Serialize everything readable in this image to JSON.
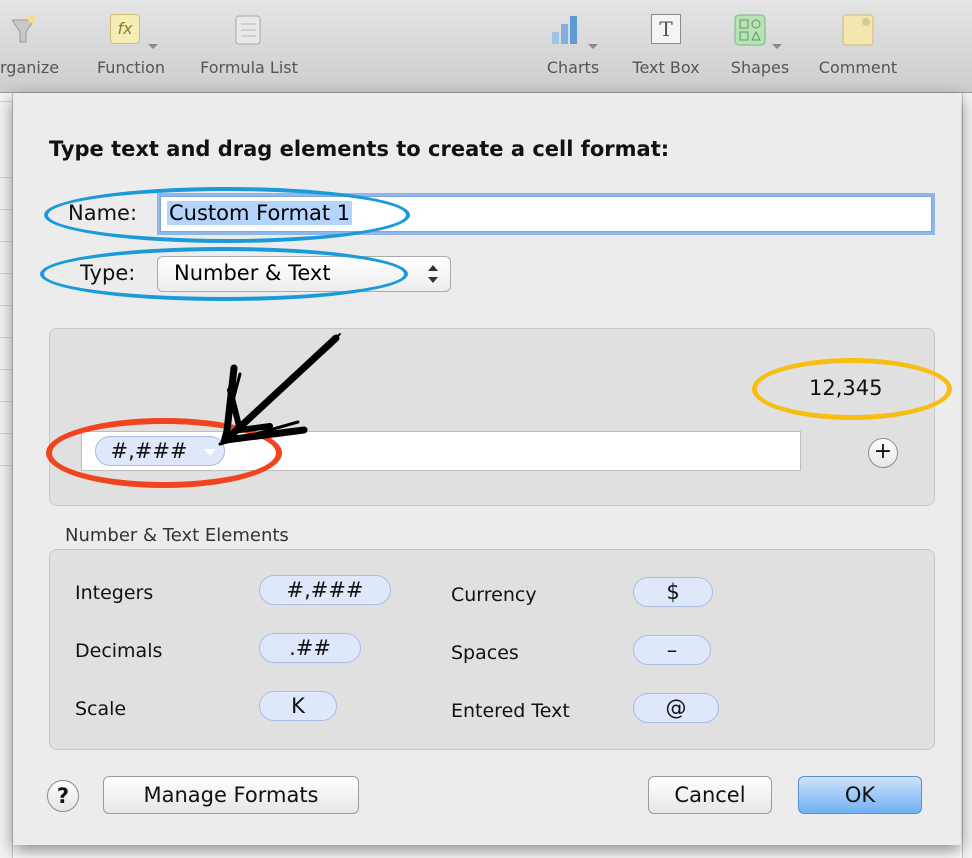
{
  "toolbar": {
    "organize_label": "rganize",
    "function_label": "Function",
    "function_icon_text": "fx",
    "formula_list_label": "Formula List",
    "charts_label": "Charts",
    "textbox_label": "Text Box",
    "textbox_icon_text": "T",
    "shapes_label": "Shapes",
    "comment_label": "Comment"
  },
  "dialog": {
    "heading": "Type text and drag elements to create a cell format:",
    "name_label": "Name:",
    "name_value": "Custom Format 1",
    "type_label": "Type:",
    "type_value": "Number & Text",
    "sample_value": "12,345",
    "format_token": "#,###",
    "plus_symbol": "+",
    "elements_title": "Number & Text Elements",
    "elements": {
      "integers_label": "Integers",
      "integers_token": "#,###",
      "decimals_label": "Decimals",
      "decimals_token": ".##",
      "scale_label": "Scale",
      "scale_token": "K",
      "currency_label": "Currency",
      "currency_token": "$",
      "spaces_label": "Spaces",
      "spaces_token": "–",
      "entered_text_label": "Entered Text",
      "entered_text_token": "@"
    },
    "help_symbol": "?",
    "manage_formats_label": "Manage Formats",
    "cancel_label": "Cancel",
    "ok_label": "OK"
  },
  "colors": {
    "annotation_blue": "#1a9ad8",
    "annotation_red": "#f0441e",
    "annotation_yellow": "#f7be12",
    "token_fill": "#dfe7fa",
    "default_button": "#6fb0f3"
  }
}
